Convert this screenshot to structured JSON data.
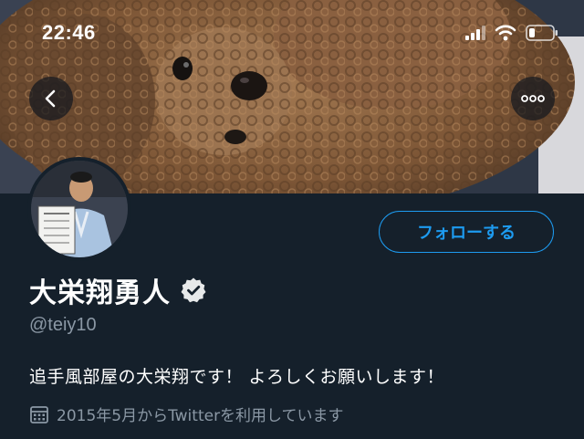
{
  "status_bar": {
    "time": "22:46",
    "icons": [
      "cellular-signal-icon",
      "wifi-icon",
      "battery-icon"
    ]
  },
  "header": {
    "banner_image": "brown curly-haired dog lying down",
    "back_icon": "chevron-left-icon",
    "more_icon": "more-horizontal-icon"
  },
  "profile": {
    "avatar": "person in light blue kimono holding a framed certificate",
    "follow_label": "フォローする",
    "display_name": "大栄翔勇人",
    "verified_icon": "verified-badge-icon",
    "handle": "@teiy10",
    "bio": "追手風部屋の大栄翔です！ よろしくお願いします！",
    "joined": "2015年5月からTwitterを利用しています",
    "joined_icon": "calendar-icon"
  },
  "colors": {
    "background": "#15202b",
    "accent": "#1d9bf0",
    "secondary_text": "#8b98a5"
  }
}
